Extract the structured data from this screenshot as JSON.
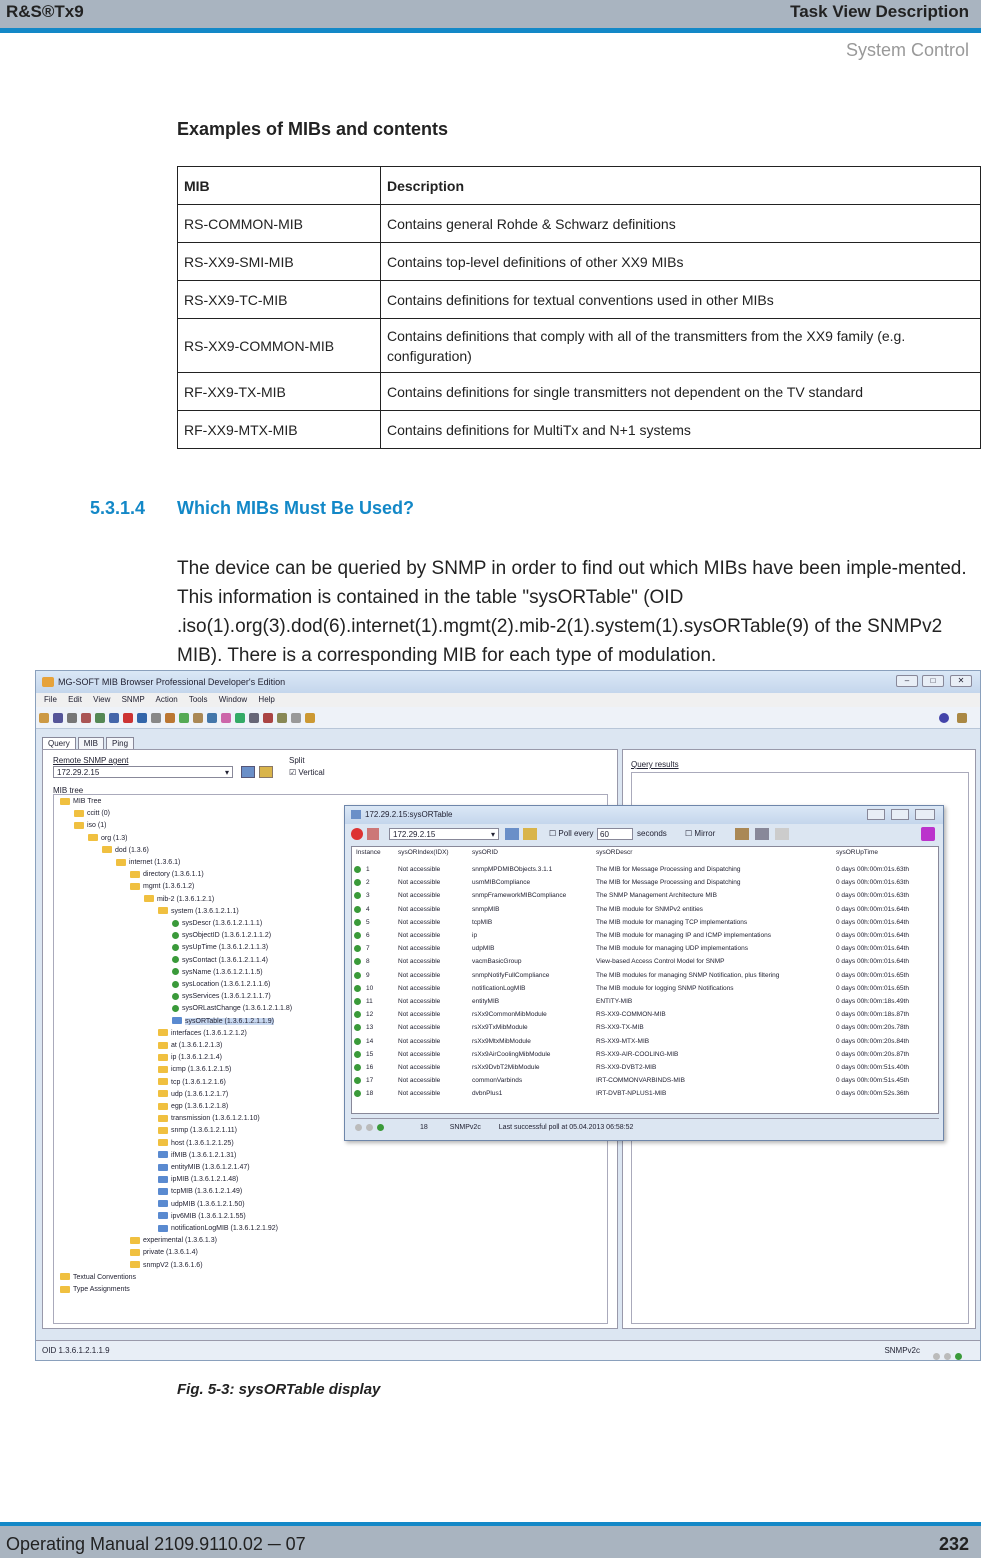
{
  "header": {
    "product": "R&S®Tx9",
    "section": "Task View Description",
    "subsection": "System Control"
  },
  "examples_title": "Examples of MIBs and contents",
  "mib_table": {
    "headers": [
      "MIB",
      "Description"
    ],
    "rows": [
      [
        "RS-COMMON-MIB",
        "Contains general Rohde & Schwarz definitions"
      ],
      [
        "RS-XX9-SMI-MIB",
        "Contains top-level definitions of other XX9 MIBs"
      ],
      [
        "RS-XX9-TC-MIB",
        "Contains definitions for textual conventions used in other MIBs"
      ],
      [
        "RS-XX9-COMMON-MIB",
        "Contains definitions that comply with all of the transmitters from the XX9 family (e.g. configuration)"
      ],
      [
        "RF-XX9-TX-MIB",
        "Contains definitions for single transmitters not dependent on the TV standard"
      ],
      [
        "RF-XX9-MTX-MIB",
        "Contains definitions for MultiTx and N+1 systems"
      ]
    ]
  },
  "section": {
    "number": "5.3.1.4",
    "title": "Which MIBs Must Be Used?"
  },
  "paragraph": "The device can be queried by SNMP in order to find out which MIBs have been imple-mented. This information is contained in the table \"sysORTable\" (OID .iso(1).org(3).dod(6).internet(1).mgmt(2).mib-2(1).system(1).sysORTable(9) of the SNMPv2 MIB). There is a corresponding MIB for each type of modulation.",
  "screenshot": {
    "window_title": "MG-SOFT MIB Browser Professional Developer's Edition",
    "menu": [
      "File",
      "Edit",
      "View",
      "SNMP",
      "Action",
      "Tools",
      "Window",
      "Help"
    ],
    "tabs": [
      "Query",
      "MIB",
      "Ping"
    ],
    "agent_label": "Remote SNMP agent",
    "agent_value": "172.29.2.15",
    "split_label": "Split",
    "vertical_label": "Vertical",
    "tree_label": "MIB tree",
    "query_results_label": "Query results",
    "tree": [
      "MIB Tree",
      "ccitt (0)",
      "iso (1)",
      "org (1.3)",
      "dod (1.3.6)",
      "internet (1.3.6.1)",
      "directory (1.3.6.1.1)",
      "mgmt (1.3.6.1.2)",
      "mib-2 (1.3.6.1.2.1)",
      "system (1.3.6.1.2.1.1)",
      "sysDescr (1.3.6.1.2.1.1.1)",
      "sysObjectID (1.3.6.1.2.1.1.2)",
      "sysUpTime (1.3.6.1.2.1.1.3)",
      "sysContact (1.3.6.1.2.1.1.4)",
      "sysName (1.3.6.1.2.1.1.5)",
      "sysLocation (1.3.6.1.2.1.1.6)",
      "sysServices (1.3.6.1.2.1.1.7)",
      "sysORLastChange (1.3.6.1.2.1.1.8)",
      "sysORTable (1.3.6.1.2.1.1.9)",
      "interfaces (1.3.6.1.2.1.2)",
      "at (1.3.6.1.2.1.3)",
      "ip (1.3.6.1.2.1.4)",
      "icmp (1.3.6.1.2.1.5)",
      "tcp (1.3.6.1.2.1.6)",
      "udp (1.3.6.1.2.1.7)",
      "egp (1.3.6.1.2.1.8)",
      "transmission (1.3.6.1.2.1.10)",
      "snmp (1.3.6.1.2.1.11)",
      "host (1.3.6.1.2.1.25)",
      "ifMIB (1.3.6.1.2.1.31)",
      "entityMIB (1.3.6.1.2.1.47)",
      "ipMIB (1.3.6.1.2.1.48)",
      "tcpMIB (1.3.6.1.2.1.49)",
      "udpMIB (1.3.6.1.2.1.50)",
      "ipv6MIB (1.3.6.1.2.1.55)",
      "notificationLogMIB (1.3.6.1.2.1.92)",
      "experimental (1.3.6.1.3)",
      "private (1.3.6.1.4)",
      "snmpV2 (1.3.6.1.6)",
      "Textual Conventions",
      "Type Assignments"
    ],
    "sysor_window": {
      "title": "172.29.2.15:sysORTable",
      "agent": "172.29.2.15",
      "poll_label": "Poll every",
      "poll_value": "60",
      "poll_unit": "seconds",
      "mirror_label": "Mirror",
      "columns": [
        "Instance",
        "sysORIndex(IDX)",
        "sysORID",
        "sysORDescr",
        "sysORUpTime"
      ],
      "rows": [
        [
          "1",
          "Not accessible",
          "snmpMPDMIBObjects.3.1.1",
          "The MIB for Message Processing and Dispatching",
          "0 days 00h:00m:01s.63th"
        ],
        [
          "2",
          "Not accessible",
          "usmMIBCompliance",
          "The MIB for Message Processing and Dispatching",
          "0 days 00h:00m:01s.63th"
        ],
        [
          "3",
          "Not accessible",
          "snmpFrameworkMIBCompliance",
          "The SNMP Management Architecture MIB",
          "0 days 00h:00m:01s.63th"
        ],
        [
          "4",
          "Not accessible",
          "snmpMIB",
          "The MIB module for SNMPv2 entities",
          "0 days 00h:00m:01s.64th"
        ],
        [
          "5",
          "Not accessible",
          "tcpMIB",
          "The MIB module for managing TCP implementations",
          "0 days 00h:00m:01s.64th"
        ],
        [
          "6",
          "Not accessible",
          "ip",
          "The MIB module for managing IP and ICMP implementations",
          "0 days 00h:00m:01s.64th"
        ],
        [
          "7",
          "Not accessible",
          "udpMIB",
          "The MIB module for managing UDP implementations",
          "0 days 00h:00m:01s.64th"
        ],
        [
          "8",
          "Not accessible",
          "vacmBasicGroup",
          "View-based Access Control Model for SNMP",
          "0 days 00h:00m:01s.64th"
        ],
        [
          "9",
          "Not accessible",
          "snmpNotifyFullCompliance",
          "The MIB modules for managing SNMP Notification, plus filtering",
          "0 days 00h:00m:01s.65th"
        ],
        [
          "10",
          "Not accessible",
          "notificationLogMIB",
          "The MIB module for logging SNMP Notifications",
          "0 days 00h:00m:01s.65th"
        ],
        [
          "11",
          "Not accessible",
          "entityMIB",
          "ENTITY-MIB",
          "0 days 00h:00m:18s.49th"
        ],
        [
          "12",
          "Not accessible",
          "rsXx9CommonMibModule",
          "RS-XX9-COMMON-MIB",
          "0 days 00h:00m:18s.87th"
        ],
        [
          "13",
          "Not accessible",
          "rsXx9TxMibModule",
          "RS-XX9-TX-MIB",
          "0 days 00h:00m:20s.78th"
        ],
        [
          "14",
          "Not accessible",
          "rsXx9MtxMibModule",
          "RS-XX9-MTX-MIB",
          "0 days 00h:00m:20s.84th"
        ],
        [
          "15",
          "Not accessible",
          "rsXx9AirCoolingMibModule",
          "RS-XX9-AIR-COOLING-MIB",
          "0 days 00h:00m:20s.87th"
        ],
        [
          "16",
          "Not accessible",
          "rsXx9DvbT2MibModule",
          "RS-XX9-DVBT2-MIB",
          "0 days 00h:00m:51s.40th"
        ],
        [
          "17",
          "Not accessible",
          "commonVarbinds",
          "IRT-COMMONVARBINDS-MIB",
          "0 days 00h:00m:51s.45th"
        ],
        [
          "18",
          "Not accessible",
          "dvbnPlus1",
          "IRT-DVBT-NPLUS1-MIB",
          "0 days 00h:00m:52s.36th"
        ]
      ],
      "status_count": "18",
      "status_proto": "SNMPv2c",
      "status_text": "Last successful poll at 05.04.2013 06:58:52"
    },
    "statusbar_oid": "OID 1.3.6.1.2.1.1.9",
    "statusbar_proto": "SNMPv2c"
  },
  "caption": "Fig. 5-3: sysORTable display",
  "footer": {
    "manual": "Operating Manual 2109.9110.02 ─ 07",
    "page": "232"
  }
}
